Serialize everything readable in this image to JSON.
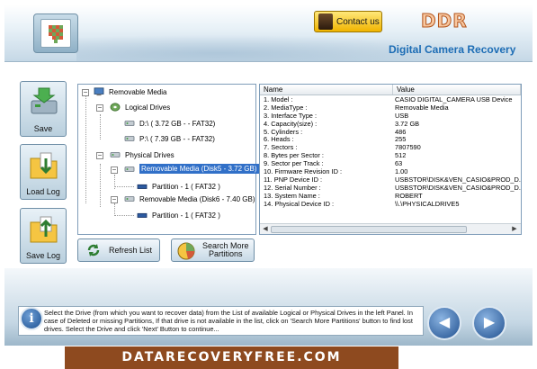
{
  "header": {
    "contact_label": "Contact us",
    "brand": "DDR",
    "subtitle": "Digital Camera Recovery"
  },
  "side_buttons": {
    "save": "Save",
    "load_log": "Load Log",
    "save_log": "Save Log"
  },
  "tree": {
    "root": "Removable Media",
    "logical_drives": "Logical Drives",
    "logical_d": "D:\\ ( 3.72 GB -  - FAT32)",
    "logical_p": "P:\\ ( 7.39 GB -  - FAT32)",
    "physical_drives": "Physical Drives",
    "disk5": "Removable Media (Disk5 - 3.72 GB)",
    "disk5_partition": "Partition - 1 ( FAT32 )",
    "disk6": "Removable Media (Disk6 - 7.40 GB)",
    "disk6_partition": "Partition - 1 ( FAT32 )"
  },
  "buttons": {
    "refresh": "Refresh List",
    "search_line1": "Search More",
    "search_line2": "Partitions"
  },
  "grid": {
    "col_name": "Name",
    "col_value": "Value",
    "rows": [
      {
        "name": "1. Model :",
        "value": "CASIO DIGITAL_CAMERA USB Device"
      },
      {
        "name": "2. MediaType :",
        "value": "Removable Media"
      },
      {
        "name": "3. Interface Type :",
        "value": "USB"
      },
      {
        "name": "4. Capacity(size) :",
        "value": "3.72 GB"
      },
      {
        "name": "5. Cylinders :",
        "value": "486"
      },
      {
        "name": "6. Heads :",
        "value": "255"
      },
      {
        "name": "7. Sectors :",
        "value": "7807590"
      },
      {
        "name": "8. Bytes per Sector :",
        "value": "512"
      },
      {
        "name": "9. Sector per Track :",
        "value": "63"
      },
      {
        "name": "10. Firmware Revision ID :",
        "value": "1.00"
      },
      {
        "name": "11. PNP Device ID :",
        "value": "USBSTOR\\DISK&VEN_CASIO&PROD_D..."
      },
      {
        "name": "12. Serial Number :",
        "value": "USBSTOR\\DISK&VEN_CASIO&PROD_D..."
      },
      {
        "name": "13. System Name :",
        "value": "ROBERT"
      },
      {
        "name": "14. Physical Device ID :",
        "value": "\\\\.\\PHYSICALDRIVE5"
      }
    ]
  },
  "info_text": "Select the Drive (from which you want to recover data) from the List of available Logical or Physical Drives in the left Panel. In case of Deleted or missing Partitions, If that drive is not available in the list, click on 'Search More Partitions' button to find lost drives. Select the Drive and click 'Next' Button to continue...",
  "footer_url": "DATARECOVERYFREE.COM",
  "colors": {
    "brand_orange": "#b3541c",
    "subtitle_blue": "#1d6db5",
    "selection_blue": "#3170c8",
    "footer_brown": "#8e4a1f"
  }
}
